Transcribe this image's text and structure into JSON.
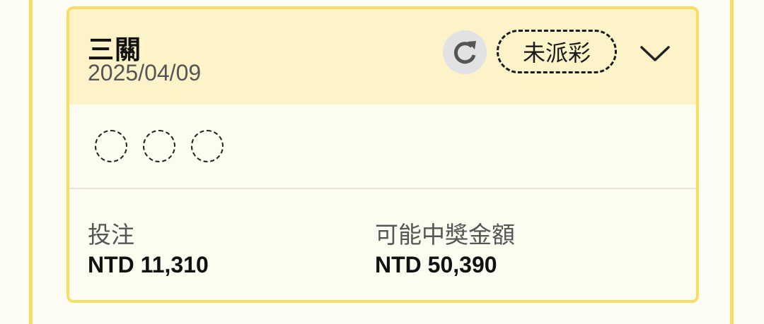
{
  "ticket": {
    "title": "三關",
    "date": "2025/04/09",
    "status": "未派彩",
    "numbers": [
      "",
      "",
      ""
    ]
  },
  "icons": {
    "refresh": "refresh-icon",
    "expand": "chevron-down-icon"
  },
  "stats": {
    "bet_label": "投注",
    "bet_value": "NTD 11,310",
    "payout_label": "可能中獎金額",
    "payout_value": "NTD 50,390"
  },
  "colors": {
    "accent_border": "#f6dd63",
    "header_bg": "#fdf3c8",
    "card_bg": "#fdfcf1"
  }
}
